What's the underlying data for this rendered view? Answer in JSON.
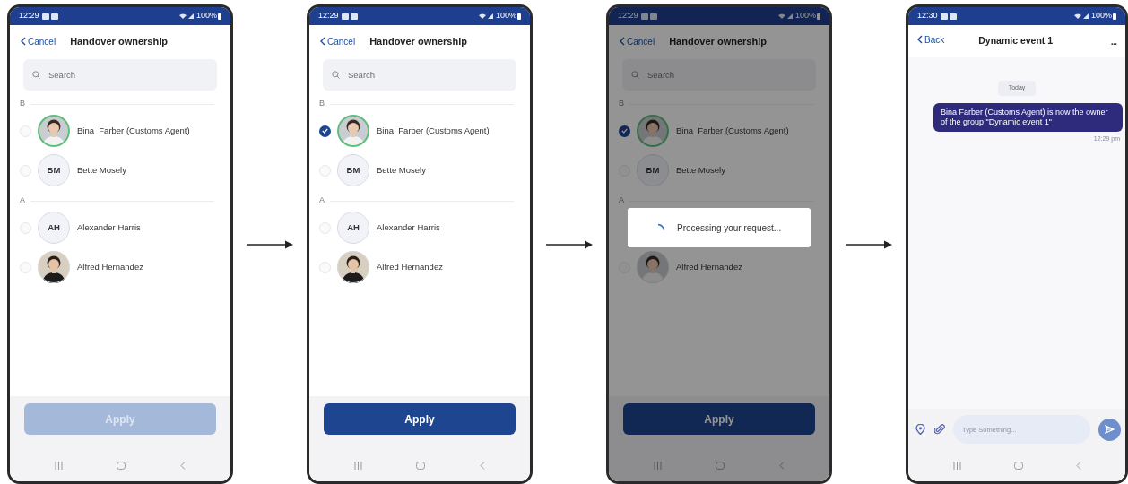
{
  "screens": [
    {
      "kind": "contact_picker",
      "status_bar": {
        "time": "12:29",
        "battery": "100%"
      },
      "header": {
        "back": "Cancel",
        "title": "Handover ownership"
      },
      "search": {
        "placeholder": "Search"
      },
      "sections": [
        {
          "letter": "B",
          "contacts": [
            {
              "name": "Bina  Farber (Customs Agent)",
              "highlighted": true,
              "selected": false
            },
            {
              "name": "Bette Mosely",
              "avatar": {
                "kind": "initials",
                "initials": "BM"
              },
              "highlighted": false,
              "selected": false
            }
          ]
        },
        {
          "letter": "A",
          "contacts": [
            {
              "name": "Alexander Harris",
              "avatar": {
                "kind": "initials",
                "initials": "AH"
              },
              "highlighted": false,
              "selected": false
            },
            {
              "name": "Alfred Hernandez",
              "highlighted": false,
              "selected": false
            }
          ]
        }
      ],
      "apply": {
        "label": "Apply",
        "disabled": true
      }
    },
    {
      "kind": "contact_picker",
      "status_bar": {
        "time": "12:29",
        "battery": "100%"
      },
      "header": {
        "back": "Cancel",
        "title": "Handover ownership"
      },
      "search": {
        "placeholder": "Search"
      },
      "sections": [
        {
          "letter": "B",
          "contacts": [
            {
              "name": "Bina  Farber (Customs Agent)",
              "highlighted": true,
              "selected": true
            },
            {
              "name": "Bette Mosely",
              "avatar": {
                "kind": "initials",
                "initials": "BM"
              },
              "highlighted": false,
              "selected": false
            }
          ]
        },
        {
          "letter": "A",
          "contacts": [
            {
              "name": "Alexander Harris",
              "avatar": {
                "kind": "initials",
                "initials": "AH"
              },
              "highlighted": false,
              "selected": false
            },
            {
              "name": "Alfred Hernandez",
              "highlighted": false,
              "selected": false
            }
          ]
        }
      ],
      "apply": {
        "label": "Apply",
        "disabled": false
      }
    },
    {
      "kind": "contact_picker",
      "status_bar": {
        "time": "12:29",
        "battery": "100%"
      },
      "header": {
        "back": "Cancel",
        "title": "Handover ownership"
      },
      "search": {
        "placeholder": "Search"
      },
      "sections": [
        {
          "letter": "B",
          "contacts": [
            {
              "name": "Bina  Farber (Customs Agent)",
              "highlighted": true,
              "selected": true
            },
            {
              "name": "Bette Mosely",
              "avatar": {
                "kind": "initials",
                "initials": "BM"
              },
              "highlighted": false,
              "selected": false
            }
          ]
        },
        {
          "letter": "A",
          "contacts": [
            {
              "name": "Alfred Hernandez",
              "highlighted": false,
              "selected": false
            }
          ]
        }
      ],
      "apply": {
        "label": "Apply",
        "disabled": false
      },
      "busy": {
        "message": "Processing your request..."
      }
    },
    {
      "kind": "chat",
      "status_bar": {
        "time": "12:30",
        "battery": "100%"
      },
      "header": {
        "back": "Back",
        "title": "Dynamic event 1",
        "more": "..."
      },
      "date": "Today",
      "messages": [
        {
          "text": "Bina  Farber (Customs Agent) is now the owner of the group \"Dynamic event 1\"",
          "time": "12:29 pm"
        }
      ],
      "composer": {
        "placeholder": "Type Something..."
      }
    }
  ]
}
